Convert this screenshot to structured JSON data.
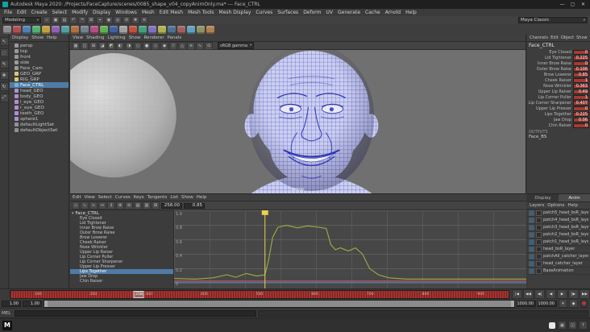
{
  "window": {
    "title": "Autodesk Maya 2020: /Projects/FaceCapture/scenes/0085_shape_v04_copyAnimOnly.ma* --- Face_CTRL",
    "controls": [
      {
        "name": "minimize-button",
        "glyph": "—"
      },
      {
        "name": "maximize-button",
        "glyph": "▢"
      },
      {
        "name": "close-button",
        "glyph": "✕"
      }
    ]
  },
  "menu_bar": {
    "items": [
      "File",
      "Edit",
      "Create",
      "Select",
      "Modify",
      "Display",
      "Windows",
      "Mesh",
      "Edit Mesh",
      "Mesh Tools",
      "Mesh Display",
      "Curves",
      "Surfaces",
      "Deform",
      "UV",
      "Generate",
      "Cache",
      "Arnold",
      "Help"
    ]
  },
  "status_line": {
    "menu_set": "Modeling",
    "workspace": "Maya Classic",
    "icons": [
      {
        "name": "new-scene-icon",
        "glyph": "▱"
      },
      {
        "name": "open-scene-icon",
        "glyph": "▣"
      },
      {
        "name": "save-scene-icon",
        "glyph": "▤"
      },
      {
        "name": "undo-icon",
        "glyph": "↶"
      },
      {
        "name": "redo-icon",
        "glyph": "↷"
      },
      {
        "name": "snap-to-grid-icon",
        "glyph": "⊞"
      },
      {
        "name": "snap-to-curve-icon",
        "glyph": "⌖"
      },
      {
        "name": "snap-to-point-icon",
        "glyph": "◉"
      },
      {
        "name": "snap-to-plane-icon",
        "glyph": "◎"
      },
      {
        "name": "make-live-icon",
        "glyph": "⊘"
      },
      {
        "name": "construction-history-icon",
        "glyph": "✚"
      },
      {
        "name": "render-settings-icon",
        "glyph": "≡"
      }
    ]
  },
  "shelf": {
    "items": [
      {
        "name": "shelf-poly-sphere",
        "color": "#8a8a8a"
      },
      {
        "name": "shelf-poly-cube",
        "color": "#b05050"
      },
      {
        "name": "shelf-poly-cylinder",
        "color": "#5080b0"
      },
      {
        "name": "shelf-poly-plane",
        "color": "#50b070"
      },
      {
        "name": "shelf-poly-torus",
        "color": "#c0a040"
      },
      {
        "name": "shelf-curve-cv",
        "color": "#9060b0"
      },
      {
        "name": "shelf-curve-ep",
        "color": "#50a0a0"
      },
      {
        "name": "shelf-pencil",
        "color": "#b07040"
      },
      {
        "name": "shelf-arc",
        "color": "#708090"
      },
      {
        "name": "shelf-text",
        "color": "#b05080"
      },
      {
        "name": "shelf-boolean",
        "color": "#60b050"
      },
      {
        "name": "shelf-combine",
        "color": "#4060a0"
      },
      {
        "name": "shelf-separate",
        "color": "#a0a0a0"
      },
      {
        "name": "shelf-extrude",
        "color": "#c05040"
      },
      {
        "name": "shelf-bevel",
        "color": "#40a080"
      },
      {
        "name": "shelf-bridge",
        "color": "#8070c0"
      },
      {
        "name": "shelf-multi-cut",
        "color": "#b0b050"
      },
      {
        "name": "shelf-target-weld",
        "color": "#507090"
      },
      {
        "name": "shelf-quad-draw",
        "color": "#a06060"
      },
      {
        "name": "shelf-mirror",
        "color": "#60a0c0"
      },
      {
        "name": "shelf-smooth",
        "color": "#909060"
      },
      {
        "name": "shelf-crease",
        "color": "#b08050"
      }
    ]
  },
  "toolbox": {
    "tools": [
      {
        "name": "select-tool",
        "glyph": "↖"
      },
      {
        "name": "lasso-tool",
        "glyph": "◌"
      },
      {
        "name": "paint-select-tool",
        "glyph": "✎"
      },
      {
        "name": "move-tool",
        "glyph": "✥"
      },
      {
        "name": "rotate-tool",
        "glyph": "↻"
      },
      {
        "name": "scale-tool",
        "glyph": "⤢"
      }
    ]
  },
  "outliner": {
    "menus": [
      "Display",
      "Show",
      "Help"
    ],
    "items": [
      {
        "label": "persp",
        "color": "#9a9a9a"
      },
      {
        "label": "top",
        "color": "#9a9a9a"
      },
      {
        "label": "front",
        "color": "#9a9a9a"
      },
      {
        "label": "side",
        "color": "#9a9a9a"
      },
      {
        "label": "Face_Cam",
        "color": "#9a9a9a"
      },
      {
        "label": "GEO_GRP",
        "color": "#d8c878"
      },
      {
        "label": "RIG_GRP",
        "color": "#d8c878"
      },
      {
        "label": "Face_CTRL",
        "color": "#78b0d8",
        "selected": true
      },
      {
        "label": "head_GEO",
        "color": "#b090d0"
      },
      {
        "label": "body_GEO",
        "color": "#b090d0"
      },
      {
        "label": "l_eye_GEO",
        "color": "#b090d0"
      },
      {
        "label": "r_eye_GEO",
        "color": "#b090d0"
      },
      {
        "label": "teeth_GEO",
        "color": "#b090d0"
      },
      {
        "label": "sphere1",
        "color": "#b090d0"
      },
      {
        "label": "defaultLightSet",
        "color": "#909090"
      },
      {
        "label": "defaultObjectSet",
        "color": "#909090"
      }
    ]
  },
  "viewport": {
    "menus": [
      "View",
      "Shading",
      "Lighting",
      "Show",
      "Renderer",
      "Panels"
    ],
    "view_transform": "sRGB gamma",
    "camera_label": "persp",
    "toolbar_icons": [
      {
        "name": "select-camera-icon",
        "glyph": "▦"
      },
      {
        "name": "lock-camera-icon",
        "glyph": "◫"
      },
      {
        "name": "grid-icon",
        "glyph": "⊞"
      },
      {
        "name": "film-gate-icon",
        "glyph": "◪"
      },
      {
        "name": "resolution-gate-icon",
        "glyph": "◩"
      },
      {
        "name": "gate-mask-icon",
        "glyph": "◐"
      },
      {
        "name": "field-chart-icon",
        "glyph": "◑"
      },
      {
        "name": "safe-action-icon",
        "glyph": "○"
      },
      {
        "name": "safe-title-icon",
        "glyph": "●"
      },
      {
        "name": "wireframe-icon",
        "glyph": "◇"
      },
      {
        "name": "shaded-icon",
        "glyph": "◆"
      },
      {
        "name": "textured-icon",
        "glyph": "▽"
      },
      {
        "name": "lights-icon",
        "glyph": "△"
      },
      {
        "name": "shadows-icon",
        "glyph": "≋"
      },
      {
        "name": "ao-icon",
        "glyph": "∿"
      },
      {
        "name": "anti-alias-icon",
        "glyph": "⊙"
      }
    ]
  },
  "channel_box": {
    "menus": [
      "Channels",
      "Edit",
      "Object",
      "Show"
    ],
    "node": "Face_CTRL",
    "attributes": [
      {
        "name": "Eye Closed",
        "value": "0"
      },
      {
        "name": "Lid Tightener",
        "value": "0.225"
      },
      {
        "name": "Inner Brow Raise",
        "value": "0"
      },
      {
        "name": "Outer Brow Raise",
        "value": "0.106"
      },
      {
        "name": "Brow Lowerer",
        "value": "0.85"
      },
      {
        "name": "Cheek Raiser",
        "value": "1"
      },
      {
        "name": "Nose Wrinkler",
        "value": "0.363"
      },
      {
        "name": "Upper Lip Raiser",
        "value": "0.49"
      },
      {
        "name": "Lip Corner Puller",
        "value": "1"
      },
      {
        "name": "Lip Corner Sharpener",
        "value": "0.407"
      },
      {
        "name": "Upper Lip Presser",
        "value": "0"
      },
      {
        "name": "Lips Together",
        "value": "0.225"
      },
      {
        "name": "Jaw Drop",
        "value": "0.06"
      },
      {
        "name": "Chin Raiser",
        "value": "0"
      }
    ],
    "outputs_label": "OUTPUTS",
    "output_node": "Face_BS"
  },
  "layer_editor": {
    "tabs": [
      {
        "label": "Display",
        "selected": false
      },
      {
        "label": "Anim",
        "selected": true
      }
    ],
    "menus": [
      "Layers",
      "Options",
      "Help"
    ],
    "layers": [
      {
        "name": "patch5_head_bsR_layer"
      },
      {
        "name": "patch4_head_bsR_layer"
      },
      {
        "name": "patch3_head_bsR_layer"
      },
      {
        "name": "patch2_head_bsR_layer"
      },
      {
        "name": "patch1_head_bsR_layer"
      },
      {
        "name": "head_bsR_layer"
      },
      {
        "name": "patchAll_catcher_layer"
      },
      {
        "name": "head_catcher_layer"
      },
      {
        "name": "BaseAnimation"
      }
    ]
  },
  "graph_editor": {
    "menus": [
      "Edit",
      "View",
      "Select",
      "Curves",
      "Keys",
      "Tangents",
      "List",
      "Show",
      "Help"
    ],
    "toolbar_icons": [
      {
        "name": "move-nearest-picked-key-icon",
        "glyph": "◇"
      },
      {
        "name": "insert-keys-icon",
        "glyph": "∿"
      },
      {
        "name": "lattice-deform-keys-icon",
        "glyph": "≈"
      },
      {
        "name": "frame-all-icon",
        "glyph": "↔"
      },
      {
        "name": "frame-playback-icon",
        "glyph": "↕"
      },
      {
        "name": "spline-tangent-icon",
        "glyph": "⊕"
      },
      {
        "name": "linear-tangent-icon",
        "glyph": "⊖"
      },
      {
        "name": "flat-tangent-icon",
        "glyph": "▤"
      },
      {
        "name": "step-tangent-icon",
        "glyph": "▥"
      },
      {
        "name": "buffer-curve-icon",
        "glyph": "⊞"
      }
    ],
    "time_field": "258.00",
    "value_field": "0.85",
    "root": "Face_CTRL",
    "channels": [
      {
        "label": "Eye Closed"
      },
      {
        "label": "Lid Tightener"
      },
      {
        "label": "Inner Brow Raise"
      },
      {
        "label": "Outer Brow Raise"
      },
      {
        "label": "Brow Lowerer"
      },
      {
        "label": "Cheek Raiser"
      },
      {
        "label": "Nose Wrinkler"
      },
      {
        "label": "Upper Lip Raiser"
      },
      {
        "label": "Lip Corner Puller"
      },
      {
        "label": "Lip Corner Sharpener"
      },
      {
        "label": "Upper Lip Presser"
      },
      {
        "label": "Lips Together",
        "selected": true
      },
      {
        "label": "Jaw Drop"
      },
      {
        "label": "Chin Raiser"
      }
    ],
    "value_ticks": [
      "1.0",
      "0.8",
      "0.6",
      "0.4",
      "0.2",
      "0"
    ],
    "frame_range": [
      0,
      1000
    ],
    "playhead_color": "#e8d44a",
    "curves": [
      {
        "name": "lip-corner-puller-curve",
        "color": "#9aa545",
        "points": [
          [
            0,
            0.06
          ],
          [
            60,
            0.05
          ],
          [
            110,
            0.07
          ],
          [
            150,
            0.12
          ],
          [
            175,
            0.08
          ],
          [
            205,
            0.14
          ],
          [
            235,
            0.1
          ],
          [
            258,
            0.12
          ],
          [
            268,
            0.35
          ],
          [
            280,
            0.72
          ],
          [
            295,
            0.88
          ],
          [
            320,
            0.91
          ],
          [
            350,
            0.87
          ],
          [
            380,
            0.9
          ],
          [
            410,
            0.88
          ],
          [
            432,
            0.86
          ],
          [
            445,
            0.6
          ],
          [
            458,
            0.52
          ],
          [
            472,
            0.55
          ],
          [
            495,
            0.5
          ],
          [
            515,
            0.55
          ],
          [
            535,
            0.45
          ],
          [
            555,
            0.22
          ],
          [
            580,
            0.12
          ],
          [
            610,
            0.07
          ],
          [
            660,
            0.05
          ],
          [
            1000,
            0.05
          ]
        ]
      },
      {
        "name": "secondary-curve-red",
        "color": "#b05555",
        "points": [
          [
            0,
            0.02
          ],
          [
            1000,
            0.02
          ]
        ]
      },
      {
        "name": "secondary-curve-blue",
        "color": "#5577b0",
        "points": [
          [
            0,
            0.0
          ],
          [
            1000,
            0.0
          ]
        ]
      }
    ]
  },
  "timeline": {
    "current_frame": "258",
    "tick_labels": [
      "100",
      "200",
      "300",
      "400",
      "500",
      "600",
      "700",
      "800",
      "900"
    ],
    "playback_buttons": [
      {
        "name": "go-to-start-button",
        "glyph": "|◀"
      },
      {
        "name": "step-back-frame-button",
        "glyph": "◀◀"
      },
      {
        "name": "step-back-key-button",
        "glyph": "◀|"
      },
      {
        "name": "play-backwards-button",
        "glyph": "◀"
      },
      {
        "name": "play-forward-button",
        "glyph": "▶"
      },
      {
        "name": "step-forward-key-button",
        "glyph": "|▶"
      },
      {
        "name": "step-forward-frame-button",
        "glyph": "▶▶"
      },
      {
        "name": "go-to-end-button",
        "glyph": "▶|"
      }
    ]
  },
  "range_slider": {
    "start": "1.00",
    "playback_start": "1.00",
    "playback_end": "1000.00",
    "end": "1000.00"
  },
  "command_line": {
    "label": "MEL",
    "value": "",
    "output": ""
  },
  "help_line": {
    "text": ""
  },
  "footer": {
    "maya_badge": "M",
    "icons": [
      {
        "name": "single-pane-layout-icon",
        "glyph": "▦"
      },
      {
        "name": "four-pane-layout-icon",
        "glyph": "◫"
      },
      {
        "name": "help-icon",
        "glyph": "?"
      }
    ]
  }
}
